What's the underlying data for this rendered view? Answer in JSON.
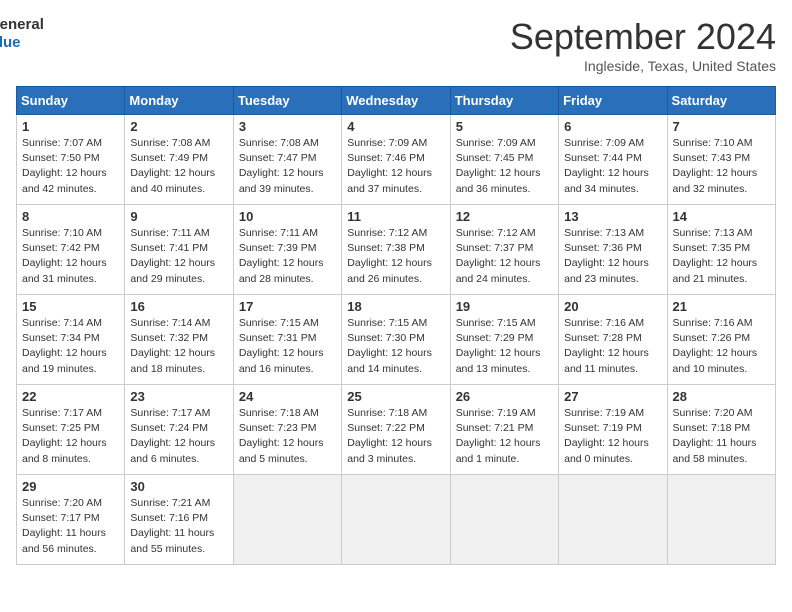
{
  "header": {
    "logo_line1": "General",
    "logo_line2": "Blue",
    "title": "September 2024",
    "location": "Ingleside, Texas, United States"
  },
  "calendar": {
    "days_of_week": [
      "Sunday",
      "Monday",
      "Tuesday",
      "Wednesday",
      "Thursday",
      "Friday",
      "Saturday"
    ],
    "weeks": [
      [
        {
          "num": "1",
          "info": "Sunrise: 7:07 AM\nSunset: 7:50 PM\nDaylight: 12 hours\nand 42 minutes."
        },
        {
          "num": "2",
          "info": "Sunrise: 7:08 AM\nSunset: 7:49 PM\nDaylight: 12 hours\nand 40 minutes."
        },
        {
          "num": "3",
          "info": "Sunrise: 7:08 AM\nSunset: 7:47 PM\nDaylight: 12 hours\nand 39 minutes."
        },
        {
          "num": "4",
          "info": "Sunrise: 7:09 AM\nSunset: 7:46 PM\nDaylight: 12 hours\nand 37 minutes."
        },
        {
          "num": "5",
          "info": "Sunrise: 7:09 AM\nSunset: 7:45 PM\nDaylight: 12 hours\nand 36 minutes."
        },
        {
          "num": "6",
          "info": "Sunrise: 7:09 AM\nSunset: 7:44 PM\nDaylight: 12 hours\nand 34 minutes."
        },
        {
          "num": "7",
          "info": "Sunrise: 7:10 AM\nSunset: 7:43 PM\nDaylight: 12 hours\nand 32 minutes."
        }
      ],
      [
        {
          "num": "8",
          "info": "Sunrise: 7:10 AM\nSunset: 7:42 PM\nDaylight: 12 hours\nand 31 minutes."
        },
        {
          "num": "9",
          "info": "Sunrise: 7:11 AM\nSunset: 7:41 PM\nDaylight: 12 hours\nand 29 minutes."
        },
        {
          "num": "10",
          "info": "Sunrise: 7:11 AM\nSunset: 7:39 PM\nDaylight: 12 hours\nand 28 minutes."
        },
        {
          "num": "11",
          "info": "Sunrise: 7:12 AM\nSunset: 7:38 PM\nDaylight: 12 hours\nand 26 minutes."
        },
        {
          "num": "12",
          "info": "Sunrise: 7:12 AM\nSunset: 7:37 PM\nDaylight: 12 hours\nand 24 minutes."
        },
        {
          "num": "13",
          "info": "Sunrise: 7:13 AM\nSunset: 7:36 PM\nDaylight: 12 hours\nand 23 minutes."
        },
        {
          "num": "14",
          "info": "Sunrise: 7:13 AM\nSunset: 7:35 PM\nDaylight: 12 hours\nand 21 minutes."
        }
      ],
      [
        {
          "num": "15",
          "info": "Sunrise: 7:14 AM\nSunset: 7:34 PM\nDaylight: 12 hours\nand 19 minutes."
        },
        {
          "num": "16",
          "info": "Sunrise: 7:14 AM\nSunset: 7:32 PM\nDaylight: 12 hours\nand 18 minutes."
        },
        {
          "num": "17",
          "info": "Sunrise: 7:15 AM\nSunset: 7:31 PM\nDaylight: 12 hours\nand 16 minutes."
        },
        {
          "num": "18",
          "info": "Sunrise: 7:15 AM\nSunset: 7:30 PM\nDaylight: 12 hours\nand 14 minutes."
        },
        {
          "num": "19",
          "info": "Sunrise: 7:15 AM\nSunset: 7:29 PM\nDaylight: 12 hours\nand 13 minutes."
        },
        {
          "num": "20",
          "info": "Sunrise: 7:16 AM\nSunset: 7:28 PM\nDaylight: 12 hours\nand 11 minutes."
        },
        {
          "num": "21",
          "info": "Sunrise: 7:16 AM\nSunset: 7:26 PM\nDaylight: 12 hours\nand 10 minutes."
        }
      ],
      [
        {
          "num": "22",
          "info": "Sunrise: 7:17 AM\nSunset: 7:25 PM\nDaylight: 12 hours\nand 8 minutes."
        },
        {
          "num": "23",
          "info": "Sunrise: 7:17 AM\nSunset: 7:24 PM\nDaylight: 12 hours\nand 6 minutes."
        },
        {
          "num": "24",
          "info": "Sunrise: 7:18 AM\nSunset: 7:23 PM\nDaylight: 12 hours\nand 5 minutes."
        },
        {
          "num": "25",
          "info": "Sunrise: 7:18 AM\nSunset: 7:22 PM\nDaylight: 12 hours\nand 3 minutes."
        },
        {
          "num": "26",
          "info": "Sunrise: 7:19 AM\nSunset: 7:21 PM\nDaylight: 12 hours\nand 1 minute."
        },
        {
          "num": "27",
          "info": "Sunrise: 7:19 AM\nSunset: 7:19 PM\nDaylight: 12 hours\nand 0 minutes."
        },
        {
          "num": "28",
          "info": "Sunrise: 7:20 AM\nSunset: 7:18 PM\nDaylight: 11 hours\nand 58 minutes."
        }
      ],
      [
        {
          "num": "29",
          "info": "Sunrise: 7:20 AM\nSunset: 7:17 PM\nDaylight: 11 hours\nand 56 minutes."
        },
        {
          "num": "30",
          "info": "Sunrise: 7:21 AM\nSunset: 7:16 PM\nDaylight: 11 hours\nand 55 minutes."
        },
        {
          "num": "",
          "info": ""
        },
        {
          "num": "",
          "info": ""
        },
        {
          "num": "",
          "info": ""
        },
        {
          "num": "",
          "info": ""
        },
        {
          "num": "",
          "info": ""
        }
      ]
    ]
  }
}
